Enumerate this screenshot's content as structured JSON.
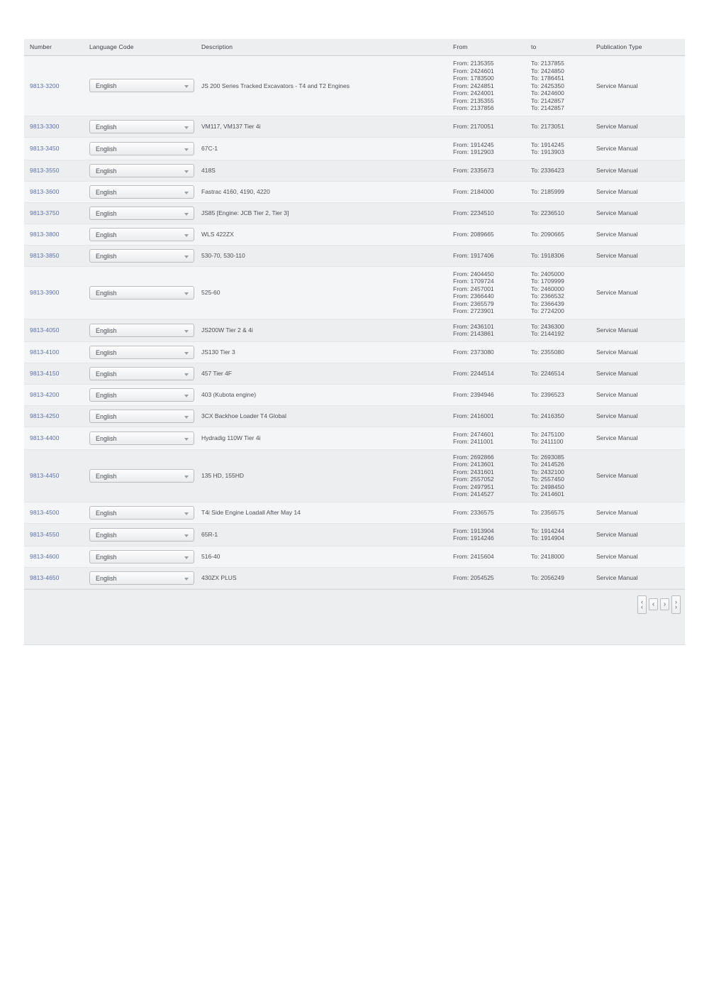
{
  "table": {
    "columns": [
      {
        "key": "number",
        "label": "Number"
      },
      {
        "key": "language",
        "label": "Language Code"
      },
      {
        "key": "description",
        "label": "Description"
      },
      {
        "key": "from",
        "label": "From"
      },
      {
        "key": "to",
        "label": "to"
      },
      {
        "key": "pubtype",
        "label": "Publication Type"
      }
    ],
    "language_selected": "English",
    "language_options": [
      "English"
    ],
    "rows": [
      {
        "number": "9813-3200",
        "language": "English",
        "description": "JS 200 Series Tracked Excavators - T4 and T2 Engines",
        "from": [
          "From: 2135355",
          "From: 2424601",
          "From: 1783500",
          "From: 2424851",
          "From: 2424001",
          "From: 2135355",
          "From: 2137856"
        ],
        "to": [
          "To: 2137855",
          "To: 2424850",
          "To: 1786451",
          "To: 2425350",
          "To: 2424600",
          "To: 2142857",
          "To: 2142857"
        ],
        "pubtype": "Service Manual"
      },
      {
        "number": "9813-3300",
        "language": "English",
        "description": "VM117, VM137 Tier 4i",
        "from": [
          "From: 2170051"
        ],
        "to": [
          "To: 2173051"
        ],
        "pubtype": "Service Manual"
      },
      {
        "number": "9813-3450",
        "language": "English",
        "description": "67C-1",
        "from": [
          "From: 1914245",
          "From: 1912903"
        ],
        "to": [
          "To: 1914245",
          "To: 1913903"
        ],
        "pubtype": "Service Manual"
      },
      {
        "number": "9813-3550",
        "language": "English",
        "description": "418S",
        "from": [
          "From: 2335673"
        ],
        "to": [
          "To: 2336423"
        ],
        "pubtype": "Service Manual"
      },
      {
        "number": "9813-3600",
        "language": "English",
        "description": "Fastrac 4160, 4190, 4220",
        "from": [
          "From: 2184000"
        ],
        "to": [
          "To: 2185999"
        ],
        "pubtype": "Service Manual"
      },
      {
        "number": "9813-3750",
        "language": "English",
        "description": "JS85 [Engine: JCB Tier 2, Tier 3]",
        "from": [
          "From: 2234510"
        ],
        "to": [
          "To: 2236510"
        ],
        "pubtype": "Service Manual"
      },
      {
        "number": "9813-3800",
        "language": "English",
        "description": "WLS 422ZX",
        "from": [
          "From: 2089665"
        ],
        "to": [
          "To: 2090665"
        ],
        "pubtype": "Service Manual"
      },
      {
        "number": "9813-3850",
        "language": "English",
        "description": "530-70, 530-110",
        "from": [
          "From: 1917406"
        ],
        "to": [
          "To: 1918306"
        ],
        "pubtype": "Service Manual"
      },
      {
        "number": "9813-3900",
        "language": "English",
        "description": "525-60",
        "from": [
          "From: 2404450",
          "From: 1709724",
          "From: 2457001",
          "From: 2366440",
          "From: 2365579",
          "From: 2723901"
        ],
        "to": [
          "To: 2405000",
          "To: 1709999",
          "To: 2460000",
          "To: 2366532",
          "To: 2366439",
          "To: 2724200"
        ],
        "pubtype": "Service Manual"
      },
      {
        "number": "9813-4050",
        "language": "English",
        "description": "JS200W Tier 2 & 4i",
        "from": [
          "From: 2436101",
          "From: 2143861"
        ],
        "to": [
          "To: 2436300",
          "To: 2144192"
        ],
        "pubtype": "Service Manual"
      },
      {
        "number": "9813-4100",
        "language": "English",
        "description": "JS130 Tier 3",
        "from": [
          "From: 2373080"
        ],
        "to": [
          "To: 2355080"
        ],
        "pubtype": "Service Manual"
      },
      {
        "number": "9813-4150",
        "language": "English",
        "description": "457 Tier 4F",
        "from": [
          "From: 2244514"
        ],
        "to": [
          "To: 2246514"
        ],
        "pubtype": "Service Manual"
      },
      {
        "number": "9813-4200",
        "language": "English",
        "description": "403 (Kubota engine)",
        "from": [
          "From: 2394946"
        ],
        "to": [
          "To: 2396523"
        ],
        "pubtype": "Service Manual"
      },
      {
        "number": "9813-4250",
        "language": "English",
        "description": "3CX Backhoe Loader T4 Global",
        "from": [
          "From: 2416001"
        ],
        "to": [
          "To: 2416350"
        ],
        "pubtype": "Service Manual"
      },
      {
        "number": "9813-4400",
        "language": "English",
        "description": "Hydradig 110W Tier 4i",
        "from": [
          "From: 2474601",
          "From: 2411001"
        ],
        "to": [
          "To: 2475100",
          "To: 2411100"
        ],
        "pubtype": "Service Manual"
      },
      {
        "number": "9813-4450",
        "language": "English",
        "description": "135 HD, 155HD",
        "from": [
          "From: 2692866",
          "From: 2413601",
          "From: 2431601",
          "From: 2557052",
          "From: 2497951",
          "From: 2414527"
        ],
        "to": [
          "To: 2693085",
          "To: 2414526",
          "To: 2432100",
          "To: 2557450",
          "To: 2498450",
          "To: 2414601"
        ],
        "pubtype": "Service Manual"
      },
      {
        "number": "9813-4500",
        "language": "English",
        "description": "T4i Side Engine Loadall After May 14",
        "from": [
          "From: 2336575"
        ],
        "to": [
          "To: 2356575"
        ],
        "pubtype": "Service Manual"
      },
      {
        "number": "9813-4550",
        "language": "English",
        "description": "65R-1",
        "from": [
          "From: 1913904",
          "From: 1914246"
        ],
        "to": [
          "To: 1914244",
          "To: 1914904"
        ],
        "pubtype": "Service Manual"
      },
      {
        "number": "9813-4600",
        "language": "English",
        "description": "516-40",
        "from": [
          "From: 2415604"
        ],
        "to": [
          "To: 2418000"
        ],
        "pubtype": "Service Manual"
      },
      {
        "number": "9813-4650",
        "language": "English",
        "description": "430ZX PLUS",
        "from": [
          "From: 2054525"
        ],
        "to": [
          "To: 2056249"
        ],
        "pubtype": "Service Manual"
      }
    ]
  },
  "pagination": {
    "first_label": "«",
    "prev_label": "‹",
    "next_label": "›",
    "last_label": "»"
  },
  "colors": {
    "link": "#5a6fa8",
    "header_bg": "#eceef0",
    "row_odd": "#f4f5f7",
    "row_even": "#eceef0"
  }
}
